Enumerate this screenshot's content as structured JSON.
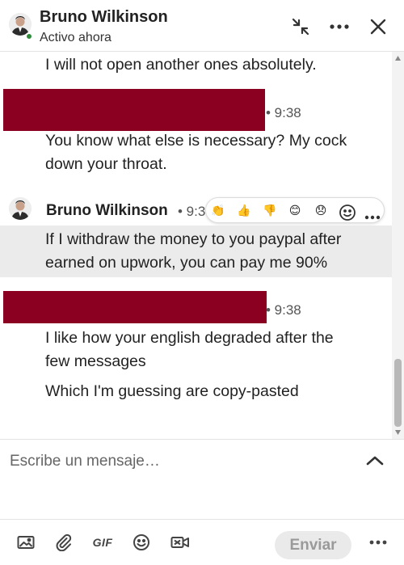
{
  "header": {
    "name": "Bruno Wilkinson",
    "status": "Activo ahora",
    "actions": [
      "minimize-icon",
      "more-icon",
      "close-icon"
    ]
  },
  "messages": {
    "lines": [
      "I will not open another ones absolutely.",
      "You know what else is necessary? My cock",
      "down your throat.",
      "If I withdraw the money to you paypal after",
      "earned on upwork, you can pay me 90%",
      "I like how your english degraded after the",
      "few messages",
      "Which I'm guessing are copy-pasted"
    ],
    "times": [
      "• 9:38",
      "• 9:3",
      "• 9:38"
    ],
    "sender_name": "Bruno Wilkinson",
    "reactions": [
      "👏",
      "👍",
      "👎",
      "😊",
      "😞"
    ],
    "reaction_tools": [
      "add-reaction-icon",
      "more-icon"
    ]
  },
  "composer": {
    "placeholder": "Escribe un mensaje…"
  },
  "footer": {
    "gif_label": "GIF",
    "send_label": "Enviar"
  },
  "colors": {
    "redaction": "#8b0020",
    "presence": "#2f8a3a",
    "highlight": "#ebebeb"
  }
}
